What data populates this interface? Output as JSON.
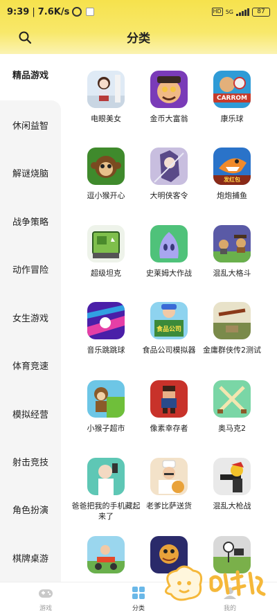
{
  "status_bar": {
    "time": "9:39",
    "separator": "|",
    "speed": "7.6K/s",
    "net_badge": "HD",
    "net_gen": "5G",
    "battery": "87"
  },
  "header": {
    "title": "分类",
    "accent_color": "#f6e24d"
  },
  "sidebar": {
    "items": [
      {
        "label": "精品游戏",
        "active": true
      },
      {
        "label": "休闲益智"
      },
      {
        "label": "解谜烧脑"
      },
      {
        "label": "战争策略"
      },
      {
        "label": "动作冒险"
      },
      {
        "label": "女生游戏"
      },
      {
        "label": "体育竞速"
      },
      {
        "label": "模拟经营"
      },
      {
        "label": "射击竞技"
      },
      {
        "label": "角色扮演"
      },
      {
        "label": "棋牌桌游"
      }
    ]
  },
  "games": [
    {
      "name": "电眼美女",
      "icon": "anime-girl-icon"
    },
    {
      "name": "金币大富翁",
      "icon": "rich-man-icon"
    },
    {
      "name": "康乐球",
      "icon": "carrom-icon",
      "icon_text": "CARROM"
    },
    {
      "name": "逗小猴开心",
      "icon": "monkey-icon"
    },
    {
      "name": "大明侠客令",
      "icon": "swordswoman-icon"
    },
    {
      "name": "炮炮捕鱼",
      "icon": "shark-icon",
      "icon_text": "发红包"
    },
    {
      "name": "超级坦克",
      "icon": "tank-icon"
    },
    {
      "name": "史莱姆大作战",
      "icon": "slime-icon"
    },
    {
      "name": "混乱大格斗",
      "icon": "brawl-icon"
    },
    {
      "name": "音乐跳跳球",
      "icon": "music-ball-icon"
    },
    {
      "name": "食品公司模拟器",
      "icon": "food-company-icon",
      "icon_text": "食品公司"
    },
    {
      "name": "金庸群侠传2测试",
      "icon": "jinyong-icon"
    },
    {
      "name": "小猴子超市",
      "icon": "monkey-market-icon"
    },
    {
      "name": "像素幸存者",
      "icon": "pixel-survivor-icon"
    },
    {
      "name": "奥马克2",
      "icon": "swords-icon"
    },
    {
      "name": "爸爸把我的手机藏起来了",
      "icon": "dad-phone-icon"
    },
    {
      "name": "老爹比萨送货",
      "icon": "pizza-chef-icon"
    },
    {
      "name": "混乱大枪战",
      "icon": "gunfight-icon"
    },
    {
      "name": "",
      "icon": "scooter-icon"
    },
    {
      "name": "",
      "icon": "dragon-icon"
    },
    {
      "name": "",
      "icon": "stickman-icon"
    }
  ],
  "bottom_nav": {
    "tabs": [
      {
        "label": "游戏",
        "icon": "gamepad-icon"
      },
      {
        "label": "分类",
        "icon": "category-icon",
        "active": true
      },
      {
        "label": "我的",
        "icon": "user-icon"
      }
    ]
  },
  "colors": {
    "active_indicator": "#f2cc2e",
    "sidebar_bg": "#f5f5f5",
    "watermark": "#f5b83a"
  }
}
